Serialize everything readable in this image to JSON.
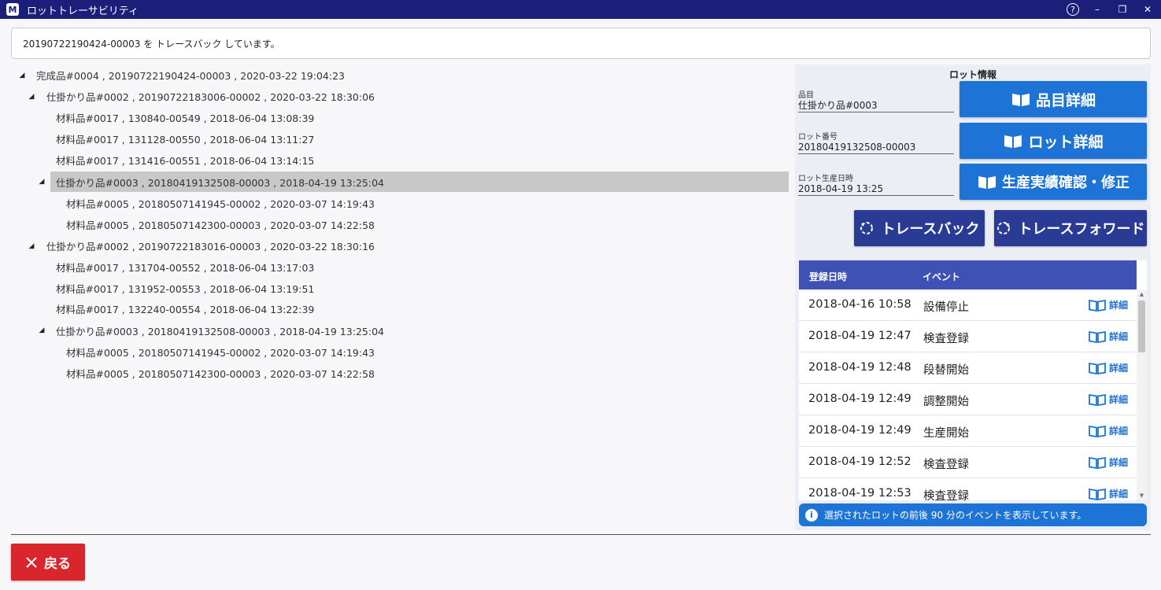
{
  "window": {
    "logo": "M",
    "title": "ロットトレーサビリティ",
    "help_icon": "?",
    "minimize_icon": "–",
    "restore_icon": "❐",
    "close_icon": "✕"
  },
  "status_message": "20190722190424-00003 を トレースバック しています。",
  "tree": {
    "rows": [
      {
        "text": "完成品#0004 , 20190722190424-00003 , 2020-03-22 19:04:23",
        "expanded": true
      },
      {
        "text": "仕掛かり品#0002 , 20190722183006-00002 , 2020-03-22 18:30:06",
        "expanded": true
      },
      {
        "text": "材料品#0017 , 130840-00549 , 2018-06-04 13:08:39"
      },
      {
        "text": "材料品#0017 , 131128-00550 , 2018-06-04 13:11:27"
      },
      {
        "text": "材料品#0017 , 131416-00551 , 2018-06-04 13:14:15"
      },
      {
        "text": "仕掛かり品#0003 , 20180419132508-00003 , 2018-04-19 13:25:04",
        "expanded": true,
        "selected": true
      },
      {
        "text": "材料品#0005 , 20180507141945-00002 , 2020-03-07 14:19:43"
      },
      {
        "text": "材料品#0005 , 20180507142300-00003 , 2020-03-07 14:22:58"
      },
      {
        "text": "仕掛かり品#0002 , 20190722183016-00003 , 2020-03-22 18:30:16",
        "expanded": true
      },
      {
        "text": "材料品#0017 , 131704-00552 , 2018-06-04 13:17:03"
      },
      {
        "text": "材料品#0017 , 131952-00553 , 2018-06-04 13:19:51"
      },
      {
        "text": "材料品#0017 , 132240-00554 , 2018-06-04 13:22:39"
      },
      {
        "text": "仕掛かり品#0003 , 20180419132508-00003 , 2018-04-19 13:25:04",
        "expanded": true
      },
      {
        "text": "材料品#0005 , 20180507141945-00002 , 2020-03-07 14:19:43"
      },
      {
        "text": "材料品#0005 , 20180507142300-00003 , 2020-03-07 14:22:58"
      }
    ]
  },
  "lot_info": {
    "title": "ロット情報",
    "item_label": "品目",
    "item_value": "仕掛かり品#0003",
    "lot_label": "ロット番号",
    "lot_value": "20180419132508-00003",
    "date_label": "ロット生産日時",
    "date_value": "2018-04-19 13:25",
    "item_detail_button": "品目詳細",
    "lot_detail_button": "ロット詳細",
    "production_button": "生産実績確認・修正",
    "traceback_button": "トレースバック",
    "traceforward_button": "トレースフォワード"
  },
  "events": {
    "col_datetime": "登録日時",
    "col_event": "イベント",
    "detail_label": "詳細",
    "rows": [
      {
        "datetime": "2018-04-16 10:58",
        "event": "設備停止"
      },
      {
        "datetime": "2018-04-19 12:47",
        "event": "検査登録"
      },
      {
        "datetime": "2018-04-19 12:48",
        "event": "段替開始"
      },
      {
        "datetime": "2018-04-19 12:49",
        "event": "調整開始"
      },
      {
        "datetime": "2018-04-19 12:49",
        "event": "生産開始"
      },
      {
        "datetime": "2018-04-19 12:52",
        "event": "検査登録"
      },
      {
        "datetime": "2018-04-19 12:53",
        "event": "検査登録"
      }
    ]
  },
  "info_message": "選択されたロットの前後 90 分のイベントを表示しています。",
  "info_icon": "i",
  "back_button": "戻る",
  "colors": {
    "title_bar": "#1b1f7a",
    "primary_blue": "#1e73d6",
    "navy": "#2a3b96",
    "table_header": "#3f51b5",
    "back_red": "#d9262c",
    "selected_row": "#c8c8c8"
  }
}
